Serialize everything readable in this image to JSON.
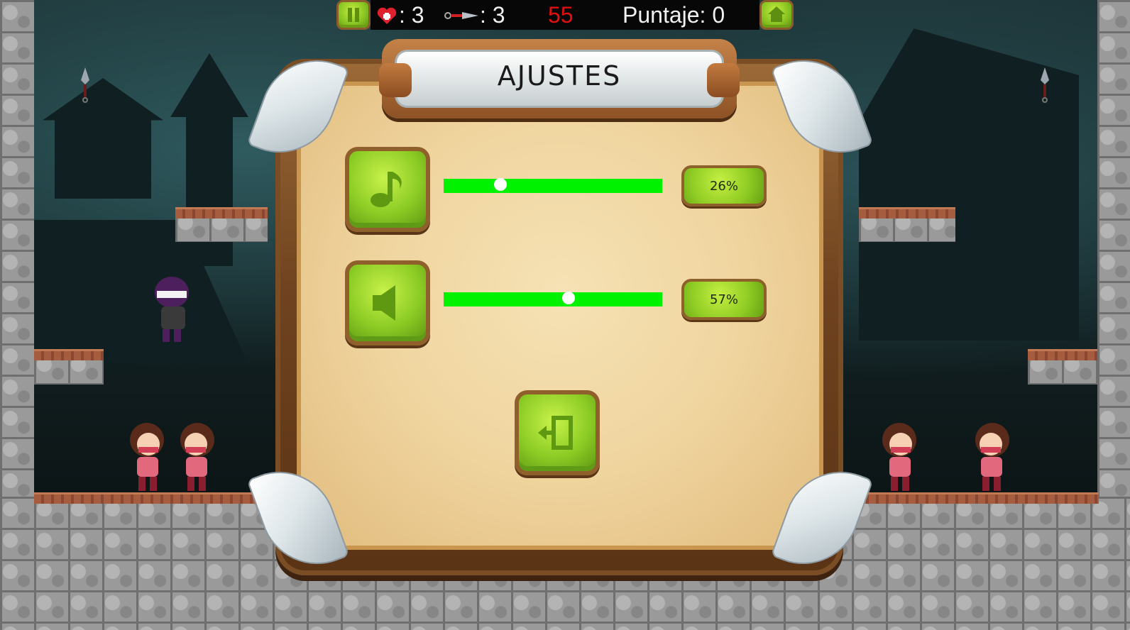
{
  "hud": {
    "lives_label": ": 3",
    "lives_value": 3,
    "shurikens_label": ": 3",
    "shurikens_value": 3,
    "timer": "55",
    "score_label": "Puntaje: 0",
    "score_value": 0,
    "pause_icon": "pause-icon",
    "home_icon": "home-icon"
  },
  "settings": {
    "title": "AJUSTES",
    "music": {
      "icon": "music-note-icon",
      "slider_level": 0.26,
      "value_text": "26%"
    },
    "sound": {
      "icon": "speaker-icon",
      "slider_level": 0.57,
      "value_text": "57%"
    },
    "exit": {
      "icon": "exit-door-icon"
    }
  },
  "colors": {
    "slider_fill": "#00f200",
    "timer_red": "#e01010",
    "button_green": "#8ccc25"
  }
}
